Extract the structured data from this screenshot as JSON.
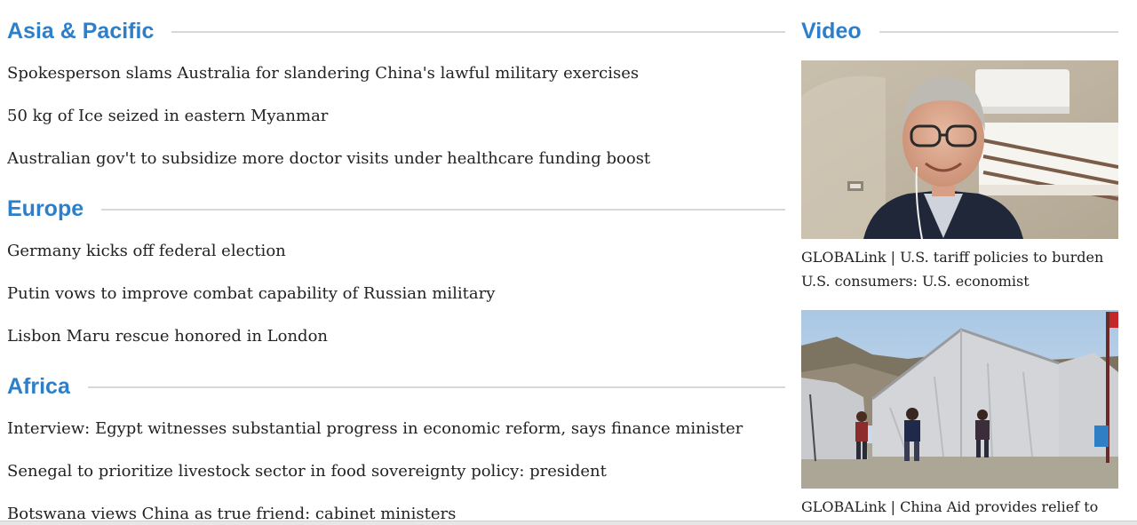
{
  "sections": [
    {
      "title": "Asia & Pacific",
      "headlines": [
        "Spokesperson slams Australia for slandering China's lawful military exercises",
        "50 kg of Ice seized in eastern Myanmar",
        "Australian gov't to subsidize more doctor visits under healthcare funding boost"
      ]
    },
    {
      "title": "Europe",
      "headlines": [
        "Germany kicks off federal election",
        "Putin vows to improve combat capability of Russian military",
        "Lisbon Maru rescue honored in London"
      ]
    },
    {
      "title": "Africa",
      "headlines": [
        "Interview: Egypt witnesses substantial progress in economic reform, says finance minister",
        "Senegal to prioritize livestock sector in food sovereignty policy: president",
        "Botswana views China as true friend: cabinet ministers"
      ]
    }
  ],
  "video": {
    "title": "Video",
    "items": [
      {
        "caption": "GLOBALink | U.S. tariff policies to burden U.S. consumers: U.S. economist"
      },
      {
        "caption": "GLOBALink | China Aid provides relief to"
      }
    ]
  },
  "colors": {
    "section_title": "#2e7fc9",
    "rule": "#d8d8d8",
    "headline_text": "#222222"
  }
}
